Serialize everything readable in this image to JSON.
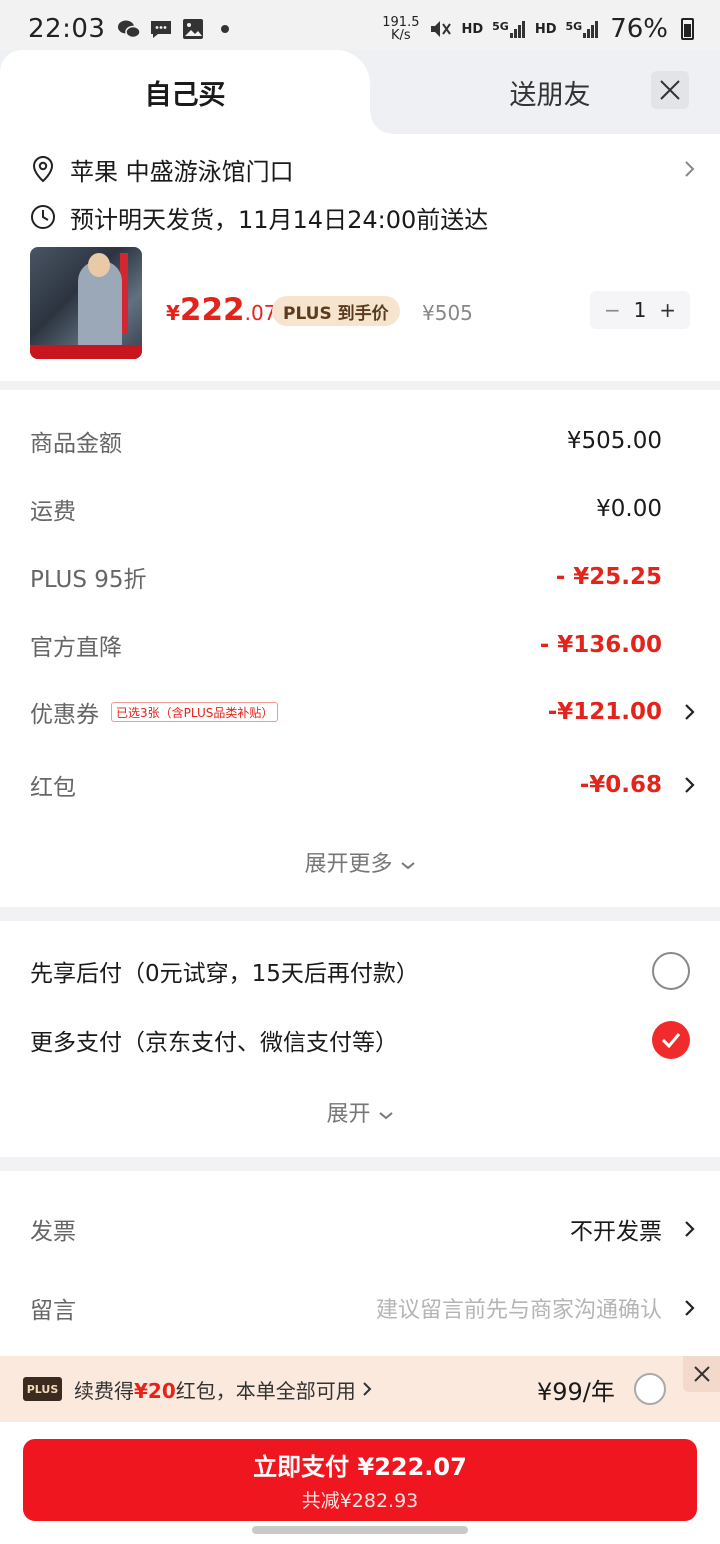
{
  "status": {
    "time": "22:03",
    "net_speed": "191.5",
    "net_unit": "K/s",
    "hd1": "HD",
    "g1": "5G",
    "hd2": "HD",
    "g2": "5G",
    "battery": "76%"
  },
  "tabs": {
    "self_buy": "自己买",
    "gift": "送朋友"
  },
  "address": {
    "text": "苹果  中盛游泳馆门口"
  },
  "shipping": {
    "text": "预计明天发货，11月14日24:00前送达"
  },
  "product": {
    "price_symbol": "¥",
    "price_int": "222",
    "price_dec": ".07",
    "plus_badge": "PLUS 到手价",
    "original_price": "¥505",
    "quantity": "1",
    "minus": "−",
    "plus": "+"
  },
  "fees": [
    {
      "label": "商品金额",
      "value": "¥505.00"
    },
    {
      "label": "运费",
      "value": "¥0.00"
    },
    {
      "label": "PLUS 95折",
      "value": "- ¥25.25"
    },
    {
      "label": "官方直降",
      "value": "- ¥136.00"
    },
    {
      "label": "优惠券",
      "tag": "已选3张（含PLUS品类补贴）",
      "value": "-¥121.00"
    },
    {
      "label": "红包",
      "value": "-¥0.68"
    }
  ],
  "expand_more": "展开更多",
  "payment": {
    "options": [
      {
        "label": "先享后付（0元试穿，15天后再付款）",
        "selected": false
      },
      {
        "label": "更多支付（京东支付、微信支付等）",
        "selected": true
      }
    ],
    "expand": "展开"
  },
  "invoice": {
    "label": "发票",
    "value": "不开发票"
  },
  "message": {
    "label": "留言",
    "placeholder": "建议留言前先与商家沟通确认"
  },
  "plus_strip": {
    "logo": "PLUS",
    "text_pre": "续费得",
    "text_hl": "¥20",
    "text_post": "红包，本单全部可用",
    "price": "¥99/年"
  },
  "pay_button": {
    "main": "立即支付 ¥222.07",
    "sub": "共减¥282.93"
  },
  "colors": {
    "accent": "#e4231b",
    "button": "#f0161f"
  }
}
